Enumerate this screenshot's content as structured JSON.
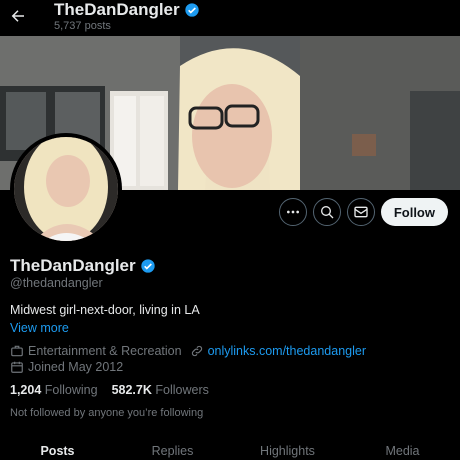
{
  "header": {
    "name": "TheDanDangler",
    "posts_count": "5,737 posts"
  },
  "actions": {
    "follow_label": "Follow"
  },
  "profile": {
    "name": "TheDanDangler",
    "handle": "@thedandangler",
    "bio": "Midwest girl-next-door, living in LA",
    "view_more": "View more",
    "category": "Entertainment & Recreation",
    "website": "onlylinks.com/thedandangler",
    "joined": "Joined May 2012",
    "following_count": "1,204",
    "following_label": "Following",
    "followers_count": "582.7K",
    "followers_label": "Followers",
    "not_followed": "Not followed by anyone you’re following"
  },
  "tabs": [
    {
      "label": "Posts"
    },
    {
      "label": "Replies"
    },
    {
      "label": "Highlights"
    },
    {
      "label": "Media"
    }
  ],
  "colors": {
    "accent": "#1d9bf0",
    "background": "#000000",
    "text_primary": "#e7e9ea",
    "text_secondary": "#71767b"
  }
}
